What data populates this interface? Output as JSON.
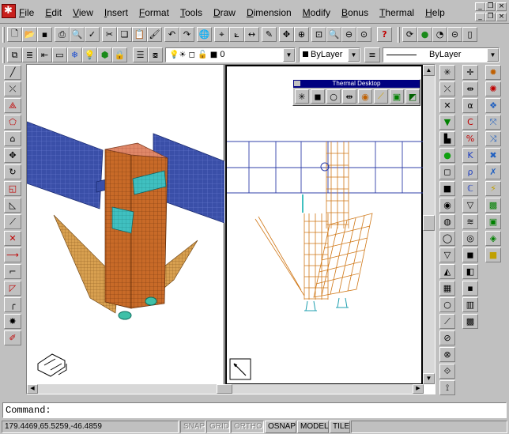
{
  "menu": {
    "items": [
      "File",
      "Edit",
      "View",
      "Insert",
      "Format",
      "Tools",
      "Draw",
      "Dimension",
      "Modify",
      "Bonus",
      "Thermal",
      "Help"
    ]
  },
  "layer_bar": {
    "layer_value": "0",
    "color_value": "ByLayer",
    "linetype_value": "ByLayer"
  },
  "thermal_toolbar": {
    "title": "Thermal Desktop"
  },
  "command": {
    "prompt": "Command:"
  },
  "status": {
    "coords": "179.4469,65.5259,-46.4859",
    "toggles": [
      {
        "label": "SNAP",
        "on": false
      },
      {
        "label": "GRID",
        "on": false
      },
      {
        "label": "ORTHO",
        "on": false
      },
      {
        "label": "OSNAP",
        "on": true
      },
      {
        "label": "MODEL",
        "on": true
      },
      {
        "label": "TILE",
        "on": true
      }
    ]
  },
  "colors": {
    "panel_blue": "#3a4fa8",
    "body_orange": "#c86a28",
    "radiator_cyan": "#40c0c0",
    "cap_salmon": "#e08868",
    "title_navy": "#000080"
  }
}
